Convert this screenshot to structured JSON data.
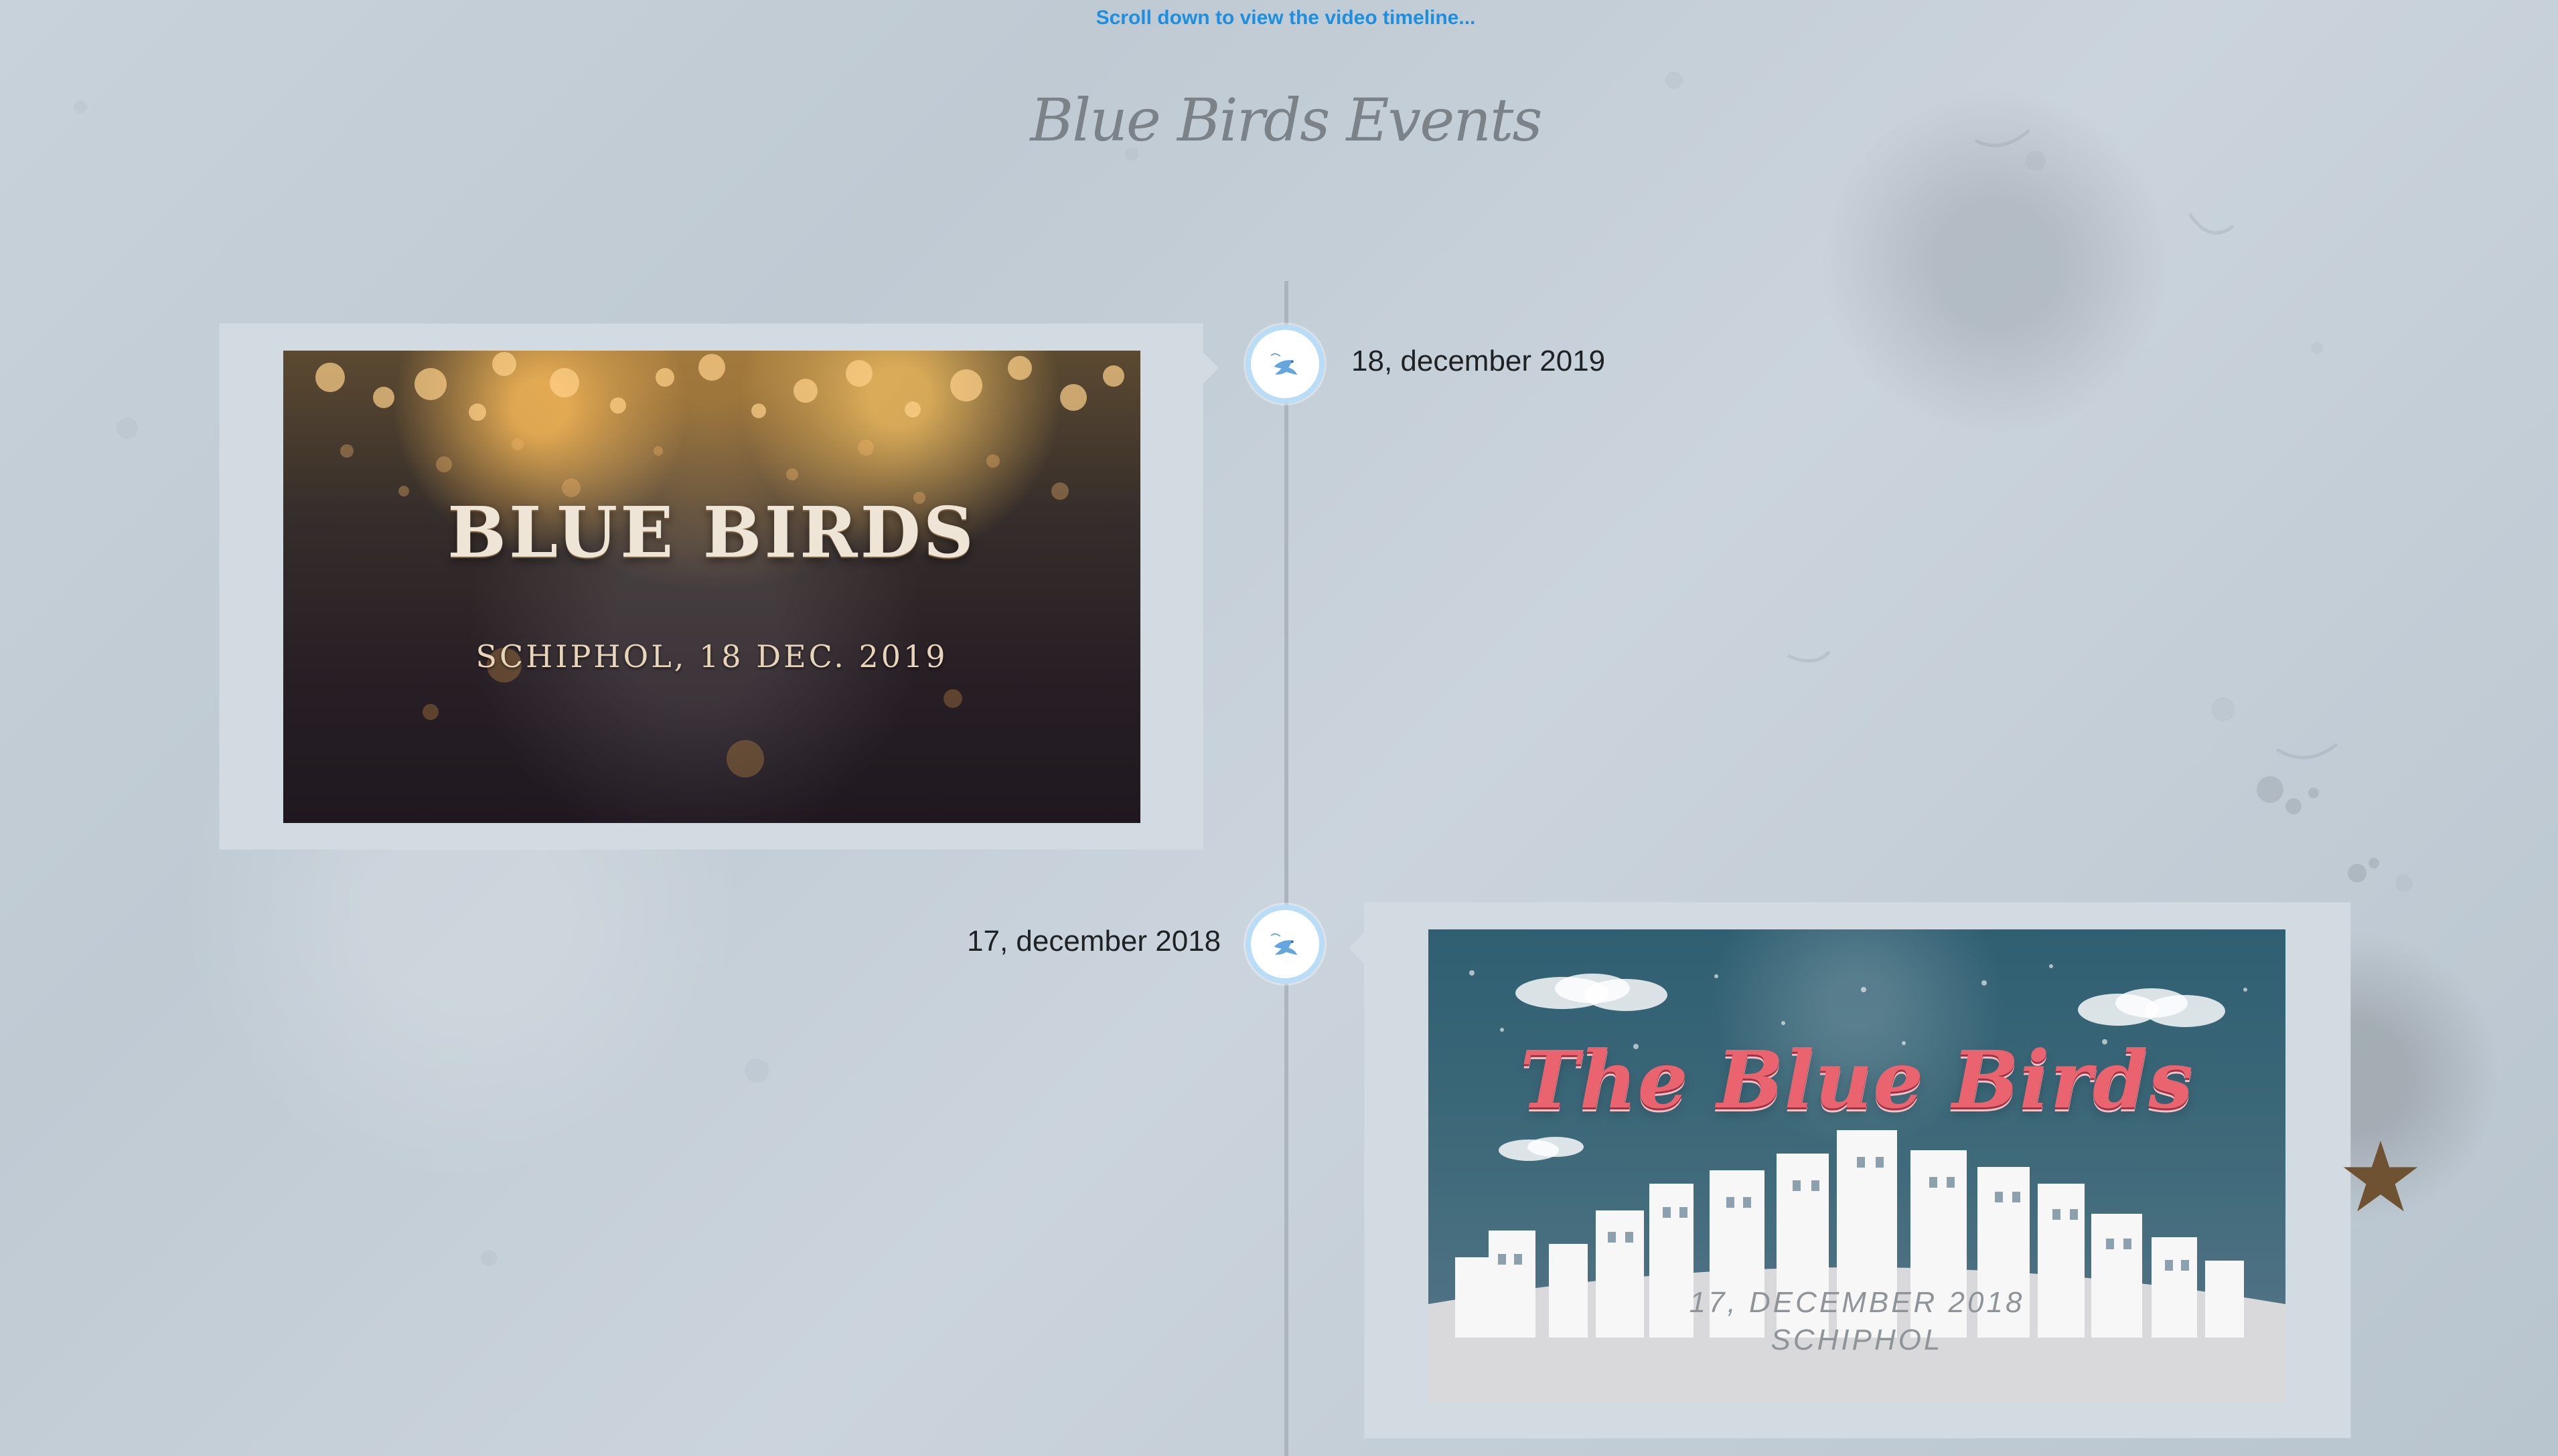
{
  "header": {
    "scroll_prompt": "Scroll down to view the video timeline...",
    "site_title": "Blue Birds Events"
  },
  "timeline": {
    "events": [
      {
        "date": "18, december 2019",
        "video_title": "BLUE BIRDS",
        "video_subtitle": "SCHIPHOL, 18 DEC. 2019"
      },
      {
        "date": "17, december 2018",
        "video_title": "The Blue Birds",
        "video_subtitle_line1": "17, DECEMBER 2018",
        "video_subtitle_line2": "SCHIPHOL"
      }
    ]
  },
  "colors": {
    "link": "#1c8fe2",
    "card_background": "#d2dae2",
    "timeline_node_border": "#b9ddf6",
    "timeline_line": "#a9b1b8"
  },
  "icons": {
    "timeline_node": "bird-icon"
  }
}
